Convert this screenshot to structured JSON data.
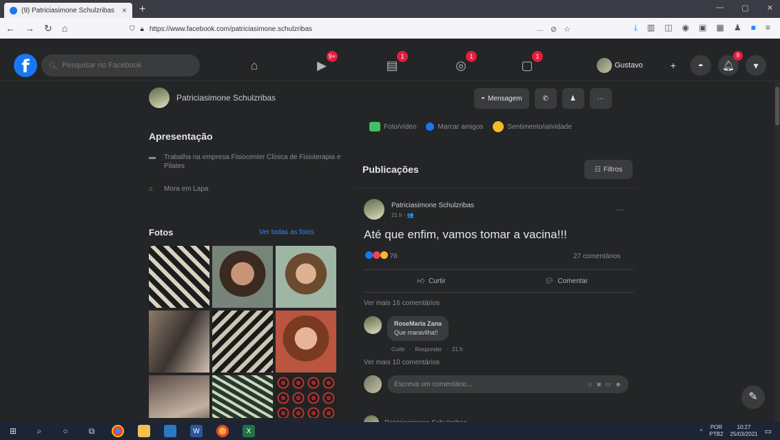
{
  "browser": {
    "tab_title": "(9) Patriciasimone Schulzribas",
    "tab_close": "×",
    "new_tab": "+",
    "url": "https://www.facebook.com/patriciasimone.schulzribas",
    "url_actions": [
      "…",
      "⊘",
      "☆"
    ],
    "window_controls": [
      "—",
      "▢",
      "✕"
    ]
  },
  "fb": {
    "search_placeholder": "Pesquisar no Facebook",
    "nav_badges": {
      "watch": "9+",
      "marketplace": "1",
      "groups": "1",
      "gaming": "1"
    },
    "profile_name": "Gustavo",
    "plus": "+",
    "notif_badge": "9"
  },
  "profile": {
    "name": "Patriciasimone Schulzribas",
    "buttons": {
      "message": "Mensagem",
      "more": "···"
    }
  },
  "intro": {
    "title": "Apresentação",
    "work": "Trabalha na empresa Fisiocenter Clínica de Fisioterapia e Pilates",
    "lives": "Mora em Lapa"
  },
  "photos": {
    "title": "Fotos",
    "see_all": "Ver todas as fotos"
  },
  "composer": {
    "photo": "Foto/vídeo",
    "tag": "Marcar amigos",
    "feeling": "Sentimento/atividade"
  },
  "feed": {
    "title": "Publicações",
    "filters": "Filtros"
  },
  "post": {
    "author": "Patriciasimone Schulzribas",
    "meta": "21 h · 👥",
    "more": "···",
    "text": "Até que enfim, vamos tomar a vacina!!!",
    "reactions_count": "76",
    "comments_count": "27 comentários",
    "like": "Curtir",
    "comment": "Comentar",
    "more_comments_1": "Ver mais 16 comentários",
    "comment_author": "RoseMaria Zana",
    "comment_text": "Que maravilha!!",
    "comment_actions": [
      "Curtir",
      "Responder",
      "21 h"
    ],
    "more_comments_2": "Ver mais 10 comentários",
    "write_placeholder": "Escreva um comentário...",
    "next_author": "Patriciasimone Schulzribas"
  },
  "taskbar": {
    "lang_top": "POR",
    "lang_bottom": "PTB2",
    "time": "10:27",
    "date": "25/03/2021"
  },
  "colors": {
    "fb_blue": "#1877f2",
    "badge_red": "#e41e3f",
    "link": "#2d88ff"
  }
}
